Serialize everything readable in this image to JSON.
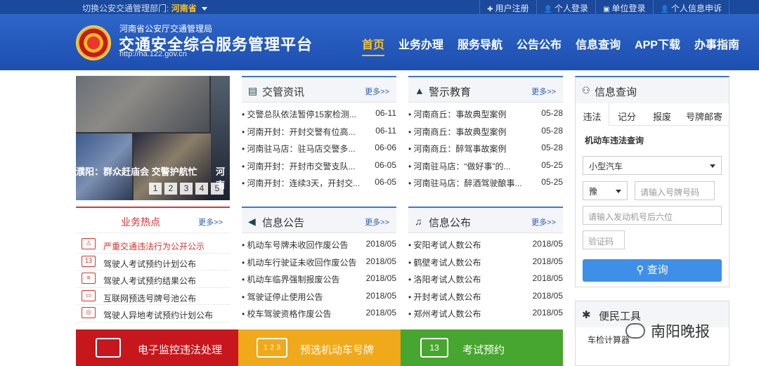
{
  "topbar": {
    "switch_label": "切换公安交通管理部门:",
    "province": "河南省",
    "links": [
      "用户注册",
      "个人登录",
      "单位登录",
      "个人信息申诉"
    ]
  },
  "header": {
    "subtitle": "河南省公安厅交通管理局",
    "title": "交通安全综合服务管理平台",
    "url": "http://ha.122.gov.cn",
    "nav": [
      "首页",
      "业务办理",
      "服务导航",
      "公告公布",
      "信息查询",
      "APP下载",
      "办事指南"
    ]
  },
  "slider": {
    "caption": "濮阳：群众赶庙会 交警护航忙",
    "caption_next": "河南",
    "pages": [
      "1",
      "2",
      "3",
      "4",
      "5"
    ]
  },
  "news": {
    "title": "交管资讯",
    "more": "更多>>",
    "items": [
      {
        "text": "• 交警总队依法暂停15家检测...",
        "date": "06-11"
      },
      {
        "text": "• 河南开封：开封交警有位高...",
        "date": "06-11"
      },
      {
        "text": "• 河南驻马店：驻马店交警多...",
        "date": "06-06"
      },
      {
        "text": "• 河南开封：开封市交警支队...",
        "date": "06-05"
      },
      {
        "text": "• 河南开封：连续3天，开封交...",
        "date": "06-05"
      }
    ]
  },
  "warning": {
    "title": "警示教育",
    "more": "更多>>",
    "items": [
      {
        "text": "• 河南商丘：事故典型案例",
        "date": "05-28"
      },
      {
        "text": "• 河南商丘：事故典型案例",
        "date": "05-28"
      },
      {
        "text": "• 河南商丘：醉驾事故案例",
        "date": "05-28"
      },
      {
        "text": "• 河南驻马店：“做好事”的...",
        "date": "05-25"
      },
      {
        "text": "• 河南驻马店：醉酒驾驶酿事...",
        "date": "05-25"
      }
    ]
  },
  "hot": {
    "title": "业务热点",
    "more": "更多>>",
    "items": [
      "严重交通违法行为公开公示",
      "驾驶人考试预约计划公布",
      "驾驶人考试预约结果公布",
      "互联网预选号牌号池公布",
      "驾驶人异地考试预约计划公布"
    ]
  },
  "notice": {
    "title": "信息公告",
    "more": "更多>>",
    "items": [
      {
        "text": "• 机动车号牌未收回作废公告",
        "date": "2018/05"
      },
      {
        "text": "• 机动车行驶证未收回作废公告",
        "date": "2018/05"
      },
      {
        "text": "• 机动车临界强制报废公告",
        "date": "2018/05"
      },
      {
        "text": "• 驾驶证停止使用公告",
        "date": "2018/05"
      },
      {
        "text": "• 校车驾驶资格作废公告",
        "date": "2018/05"
      }
    ]
  },
  "publish": {
    "title": "信息公布",
    "more": "更多>>",
    "items": [
      {
        "text": "• 安阳考试人数公布",
        "date": "2018/05"
      },
      {
        "text": "• 鹤壁考试人数公布",
        "date": "2018/05"
      },
      {
        "text": "• 洛阳考试人数公布",
        "date": "2018/05"
      },
      {
        "text": "• 开封考试人数公布",
        "date": "2018/05"
      },
      {
        "text": "• 郑州考试人数公布",
        "date": "2018/05"
      }
    ]
  },
  "query": {
    "title": "信息查询",
    "tabs": [
      "违法",
      "记分",
      "报废",
      "号牌邮寄"
    ],
    "subtitle": "机动车违法查询",
    "vehicle_type": "小型汽车",
    "plate_prefix": "豫",
    "plate_placeholder": "请输入号牌号码",
    "engine_placeholder": "请输入发动机号后六位",
    "captcha_placeholder": "验证码",
    "button": "查询"
  },
  "tools": {
    "title": "便民工具",
    "item": "车检计算器"
  },
  "watermark": "南阳晚报",
  "banners": [
    {
      "label": "电子监控违法处理",
      "color": "#c8161d"
    },
    {
      "label": "预选机动车号牌",
      "color": "#f0a91a",
      "icon": "1 2 3"
    },
    {
      "label": "考试预约",
      "color": "#47a62f",
      "icon": "13"
    }
  ]
}
